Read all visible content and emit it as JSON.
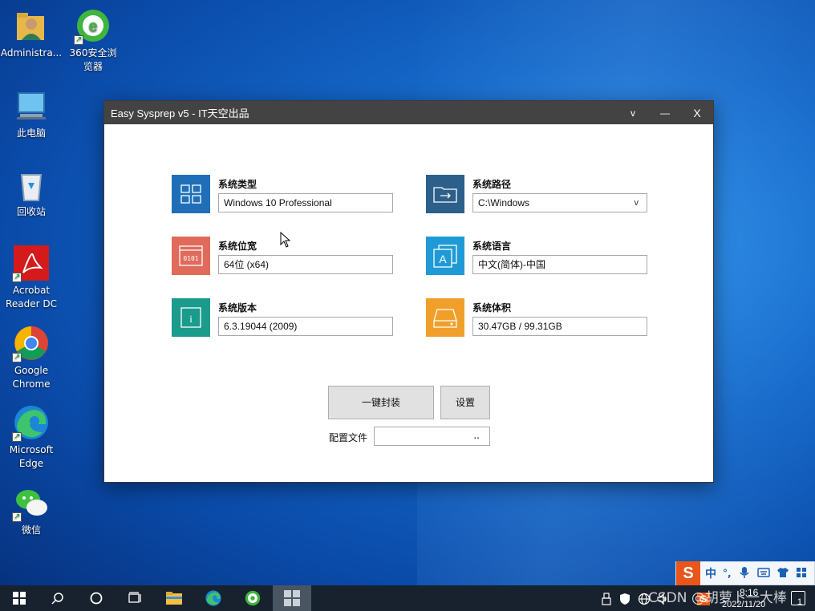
{
  "desktop": {
    "icons": [
      {
        "label": "Administra..."
      },
      {
        "label": "360安全浏览器"
      },
      {
        "label": "此电脑"
      },
      {
        "label": "回收站"
      },
      {
        "label": "Acrobat Reader DC"
      },
      {
        "label": "Google Chrome"
      },
      {
        "label": "Microsoft Edge"
      },
      {
        "label": "微信"
      }
    ]
  },
  "window": {
    "title": "Easy Sysprep v5 - IT天空出品",
    "controls": {
      "menu": "v",
      "minimize": "—",
      "close": "X"
    },
    "fields": [
      {
        "label": "系统类型",
        "value": "Windows 10 Professional",
        "color": "#1e6fb8",
        "icon": "tiles-icon"
      },
      {
        "label": "系统路径",
        "value": "C:\\Windows",
        "color": "#2c5f8a",
        "icon": "folder-arrow-icon",
        "dropdown": "v"
      },
      {
        "label": "系统位宽",
        "value": "64位 (x64)",
        "color": "#e06b5b",
        "icon": "binary-window-icon",
        "icon_text": "0101"
      },
      {
        "label": "系统语言",
        "value": "中文(简体)-中国",
        "color": "#1f9ad6",
        "icon": "language-icon",
        "icon_text": "A"
      },
      {
        "label": "系统版本",
        "value": "6.3.19044 (2009)",
        "color": "#1a9b8c",
        "icon": "info-icon",
        "icon_text": "i"
      },
      {
        "label": "系统体积",
        "value": "30.47GB / 99.31GB",
        "color": "#f0a02a",
        "icon": "disk-icon"
      }
    ],
    "buttons": {
      "seal": "一键封装",
      "settings": "设置"
    },
    "config": {
      "label": "配置文件",
      "browse": ".."
    }
  },
  "ime": {
    "mode": "中",
    "punct": "°,"
  },
  "tray": {
    "time": "8:16",
    "date": "2022/11/20",
    "notifications": "1"
  },
  "watermark": "CSDN @胡萝卜一大棒"
}
